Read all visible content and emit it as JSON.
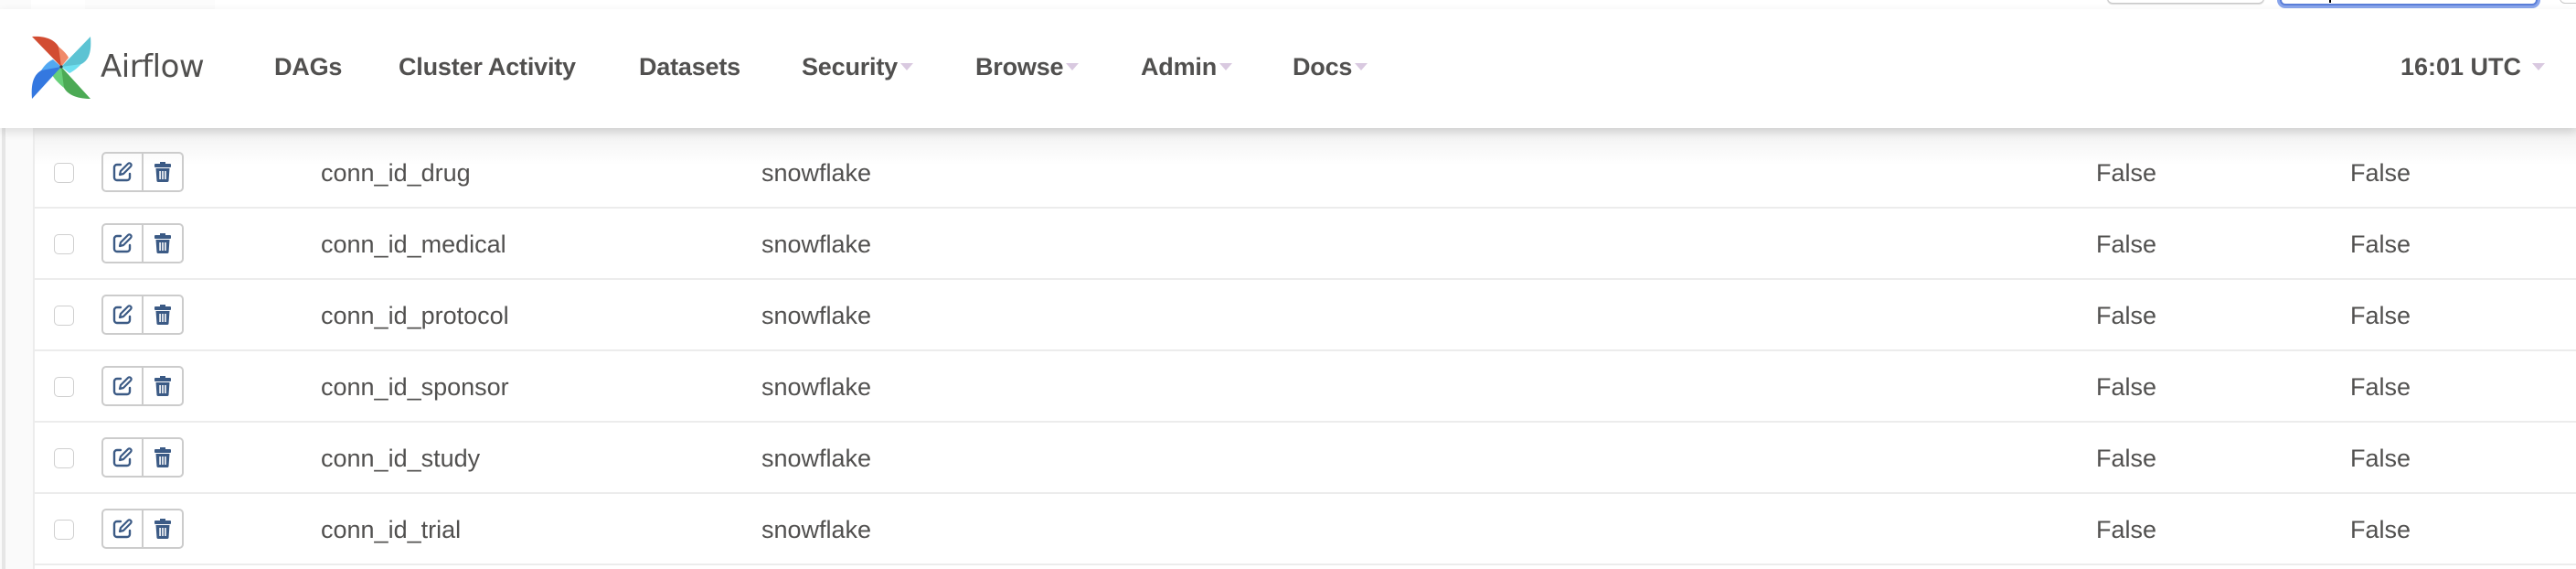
{
  "brand": {
    "name": "Airflow",
    "logo_icon": "airflow-pinwheel-logo"
  },
  "nav": {
    "items": [
      {
        "label": "DAGs",
        "dropdown": false
      },
      {
        "label": "Cluster Activity",
        "dropdown": false
      },
      {
        "label": "Datasets",
        "dropdown": false
      },
      {
        "label": "Security",
        "dropdown": true
      },
      {
        "label": "Browse",
        "dropdown": true
      },
      {
        "label": "Admin",
        "dropdown": true
      },
      {
        "label": "Docs",
        "dropdown": true
      }
    ],
    "time": "16:01 UTC"
  },
  "table": {
    "rows": [
      {
        "conn_id": "conn_id_drug",
        "conn_type": "snowflake",
        "col_a": "False",
        "col_b": "False"
      },
      {
        "conn_id": "conn_id_medical",
        "conn_type": "snowflake",
        "col_a": "False",
        "col_b": "False"
      },
      {
        "conn_id": "conn_id_protocol",
        "conn_type": "snowflake",
        "col_a": "False",
        "col_b": "False"
      },
      {
        "conn_id": "conn_id_sponsor",
        "conn_type": "snowflake",
        "col_a": "False",
        "col_b": "False"
      },
      {
        "conn_id": "conn_id_study",
        "conn_type": "snowflake",
        "col_a": "False",
        "col_b": "False"
      },
      {
        "conn_id": "conn_id_trial",
        "conn_type": "snowflake",
        "col_a": "False",
        "col_b": "False"
      }
    ],
    "row_actions": {
      "edit_icon": "edit-icon",
      "delete_icon": "trash-icon"
    }
  },
  "colors": {
    "text": "#51504f",
    "action_icon": "#3b5a85",
    "caret": "#d9c9e0",
    "focus_ring": "#8aa6ec"
  }
}
